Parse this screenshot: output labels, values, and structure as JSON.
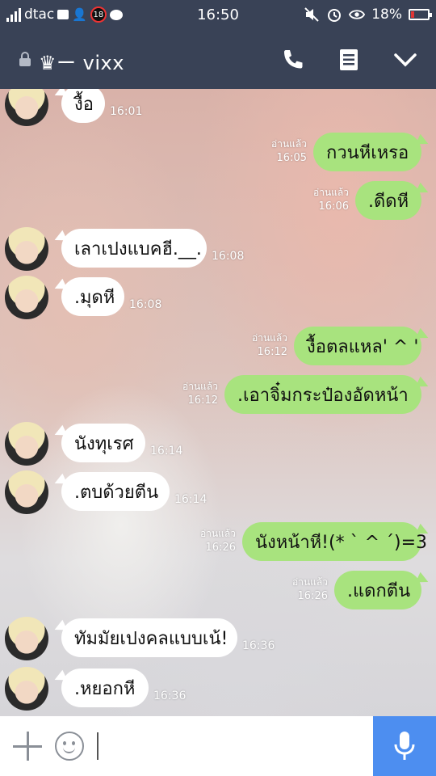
{
  "status_bar": {
    "carrier": "dtac",
    "notification_count": "18",
    "time": "16:50",
    "battery": "18%",
    "battery_level": 0.18
  },
  "header": {
    "title": "♛ー vixx"
  },
  "messages": [
    {
      "side": "in",
      "text": "งื้อ",
      "time": "16:01",
      "read": ""
    },
    {
      "side": "out",
      "text": "กวนหีเหรอ",
      "time": "16:05",
      "read": "อ่านแล้ว"
    },
    {
      "side": "out",
      "text": ".ดีดหี",
      "time": "16:06",
      "read": "อ่านแล้ว"
    },
    {
      "side": "in",
      "text": "เลาเปงแบคฮี.__.",
      "time": "16:08",
      "read": ""
    },
    {
      "side": "in",
      "text": ".มุดหี",
      "time": "16:08",
      "read": ""
    },
    {
      "side": "out",
      "text": "งื้อตลแหล' ^ '",
      "time": "16:12",
      "read": "อ่านแล้ว"
    },
    {
      "side": "out",
      "text": ".เอาจิ๋มกระป๋องอัดหน้า",
      "time": "16:12",
      "read": "อ่านแล้ว"
    },
    {
      "side": "in",
      "text": "นังทุเรศ",
      "time": "16:14",
      "read": ""
    },
    {
      "side": "in",
      "text": ".ตบด้วยตีน",
      "time": "16:14",
      "read": ""
    },
    {
      "side": "out",
      "text": "นังหน้าหี!(* ` ^ ´)=3",
      "time": "16:26",
      "read": "อ่านแล้ว"
    },
    {
      "side": "out",
      "text": ".แดกตีน",
      "time": "16:26",
      "read": "อ่านแล้ว"
    },
    {
      "side": "in",
      "text": "ทัมมัยเปงคลแบบเน้!",
      "time": "16:36",
      "read": ""
    },
    {
      "side": "in",
      "text": ".หยอกหี",
      "time": "16:36",
      "read": ""
    }
  ],
  "colors": {
    "bar": "#394256",
    "incoming_bubble": "#ffffff",
    "outgoing_bubble": "#a8e37e",
    "mic_button": "#4d8ef0",
    "battery_low": "#e03535"
  },
  "icons": {
    "call": "phone-icon",
    "notes": "notes-icon",
    "menu": "chevron-down-icon",
    "add": "plus-icon",
    "emoji": "smiley-icon",
    "voice": "microphone-icon"
  }
}
